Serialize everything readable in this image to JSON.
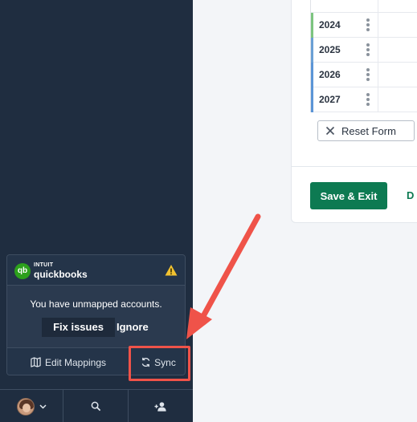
{
  "quickbooks": {
    "brand_top": "INTUIT",
    "brand_name": "quickbooks",
    "message": "You have unmapped accounts.",
    "fix_label": "Fix issues",
    "ignore_label": "Ignore",
    "edit_mappings_label": "Edit Mappings",
    "sync_label": "Sync"
  },
  "table": {
    "rows": [
      {
        "year": "2024",
        "color": "#7cc47f"
      },
      {
        "year": "2025",
        "color": "#6a9fd4"
      },
      {
        "year": "2026",
        "color": "#5b95d6"
      },
      {
        "year": "2027",
        "color": "#5b95d6"
      }
    ]
  },
  "form": {
    "reset_label": "Reset Form",
    "save_exit_label": "Save & Exit",
    "secondary_label": "D"
  },
  "colors": {
    "sidebar": "#1f2d40",
    "accent_green": "#0d7a52",
    "highlight_red": "#ef5349",
    "qb_green": "#2ca01c",
    "warning": "#f2c230"
  }
}
